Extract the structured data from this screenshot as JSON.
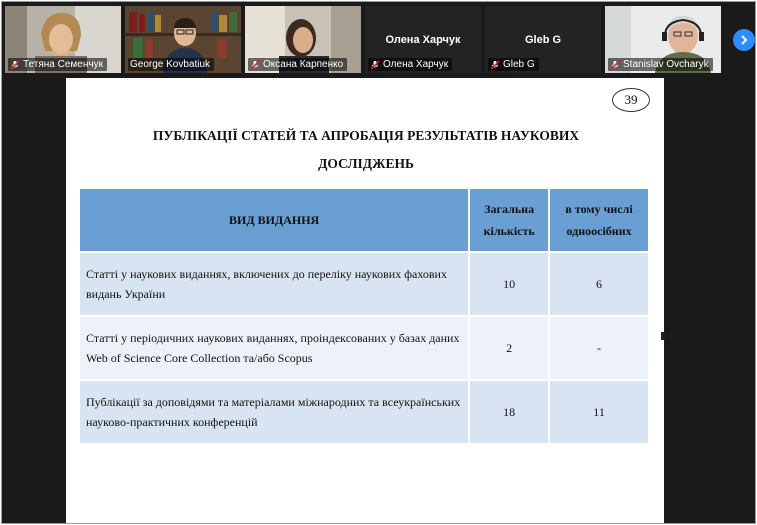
{
  "participants": [
    {
      "name": "Тетяна Семенчук",
      "video": true,
      "muted": true
    },
    {
      "name": "George Kovbatiuk",
      "video": true,
      "muted": true,
      "active_speaker": true
    },
    {
      "name": "Оксана Карпенко",
      "video": true,
      "muted": true
    },
    {
      "name": "Олена Харчук",
      "video": false,
      "muted": true
    },
    {
      "name": "Gleb G",
      "video": false,
      "muted": true
    },
    {
      "name": "Stanislav Ovcharyk",
      "video": true,
      "muted": true
    }
  ],
  "icons": {
    "mic": "mic-off-icon",
    "next": "chevron-right-icon"
  },
  "colors": {
    "header": "#6a9fd3",
    "row_dark": "#d9e4f3",
    "row_light": "#edf2f9",
    "accent": "#2d8cff",
    "active_border": "#d6c12a"
  },
  "slide": {
    "page_number": "39",
    "title": "ПУБЛІКАЦІЇ СТАТЕЙ ТА АПРОБАЦІЯ РЕЗУЛЬТАТІВ НАУКОВИХ ДОСЛІДЖЕНЬ",
    "table": {
      "headers": [
        "ВИД ВИДАННЯ",
        "Загальна кількість",
        "в тому числі одноосібних"
      ],
      "rows": [
        {
          "type": "Статті у наукових виданнях, включених до переліку наукових фахових видань України",
          "total": "10",
          "single": "6"
        },
        {
          "type": "Статті у періодичних наукових виданнях, проіндексованих у базах даних Web of Science Core Collection та/або Scopus",
          "total": "2",
          "single": "-"
        },
        {
          "type": "Публікації за доповідями та матеріалами міжнародних та всеукраїнських науково-практичних конференцій",
          "total": "18",
          "single": "11"
        }
      ]
    }
  }
}
